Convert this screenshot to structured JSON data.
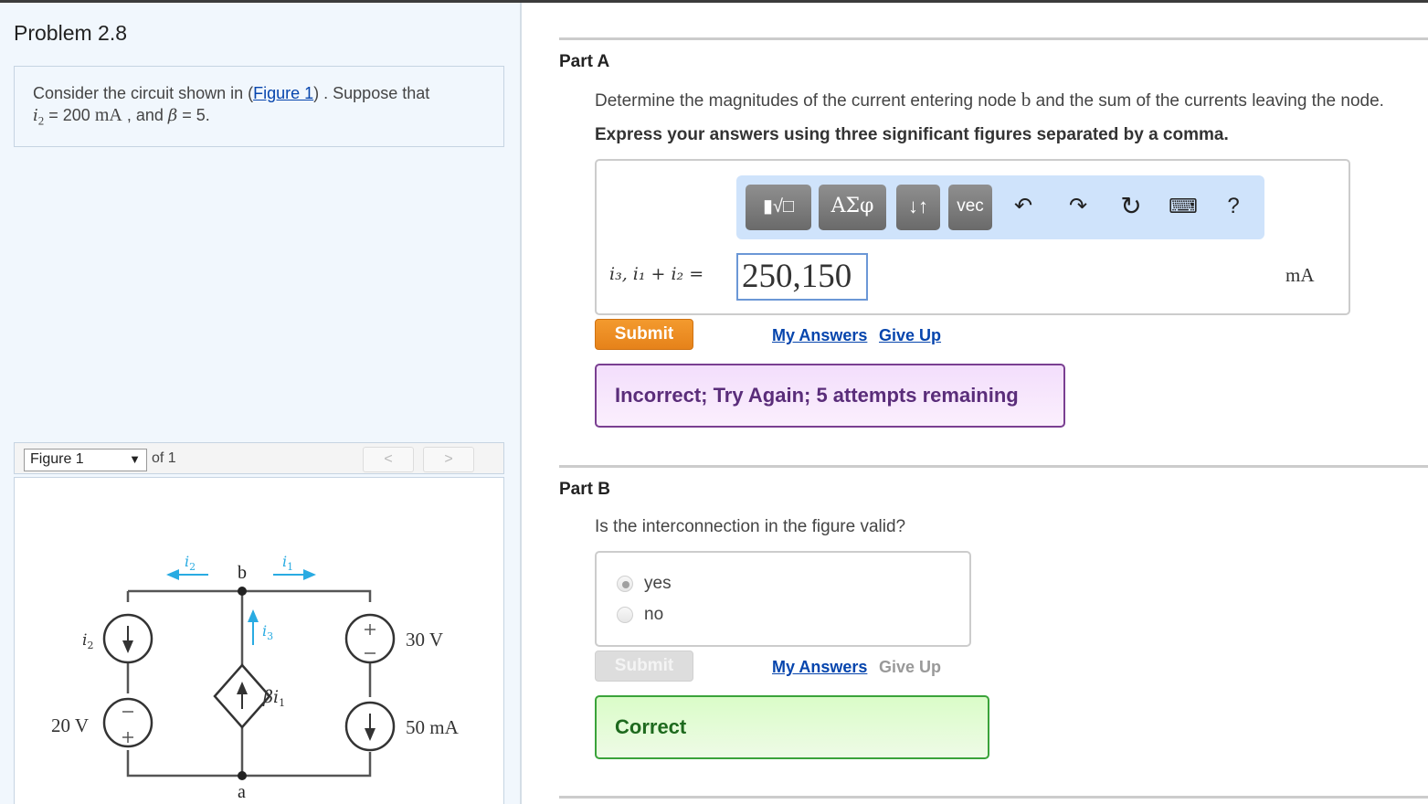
{
  "problem": {
    "title": "Problem 2.8",
    "intro_before_link": "Consider the circuit shown in (",
    "figure_link": "Figure 1",
    "intro_after_link": ") . Suppose that",
    "given_var": "i",
    "given_sub": "2",
    "given_eq": " = 200 ",
    "given_unit": "mA",
    "given_rest": " , and ",
    "beta_sym": "β",
    "beta_val": " = 5."
  },
  "figure": {
    "selector_value": "Figure 1",
    "of_label": "of 1",
    "prev_label": "<",
    "next_label": ">",
    "circuit": {
      "node_b": "b",
      "node_a": "a",
      "label_i2_arrow": "i2",
      "label_i1_arrow": "i1",
      "label_i3_arrow": "i3",
      "label_i2_source": "i2",
      "label_20V": "20 V",
      "label_30V": "30 V",
      "label_50mA": "50 mA",
      "label_dep": "βi1",
      "wire_color": "#555555",
      "arrow_color": "#29abe2"
    }
  },
  "partA": {
    "title": "Part A",
    "question_before": "Determine the magnitudes of the current entering node ",
    "question_node": "b",
    "question_after": " and the sum of the currents leaving the node.",
    "instruction": "Express your answers using three significant figures separated by a comma.",
    "toolbar": {
      "templates_label": "▮√□",
      "greek_label": "ΑΣφ",
      "arrows_label": "↓↑",
      "vec_label": "vec",
      "undo_icon": "↶",
      "redo_icon": "↷",
      "reset_icon": "↻",
      "keyboard_icon": "⌨",
      "help_icon": "?"
    },
    "answer_label": "i₃, i₁ + i₂ =",
    "answer_value": "250,150",
    "unit": "mA",
    "submit_label": "Submit",
    "my_answers_label": "My Answers",
    "give_up_label": "Give Up",
    "feedback": "Incorrect; Try Again; 5 attempts remaining"
  },
  "partB": {
    "title": "Part B",
    "question": "Is the interconnection in the figure valid?",
    "options": [
      {
        "label": "yes",
        "selected": true
      },
      {
        "label": "no",
        "selected": false
      }
    ],
    "submit_label": "Submit",
    "my_answers_label": "My Answers",
    "give_up_label": "Give Up",
    "feedback": "Correct"
  }
}
